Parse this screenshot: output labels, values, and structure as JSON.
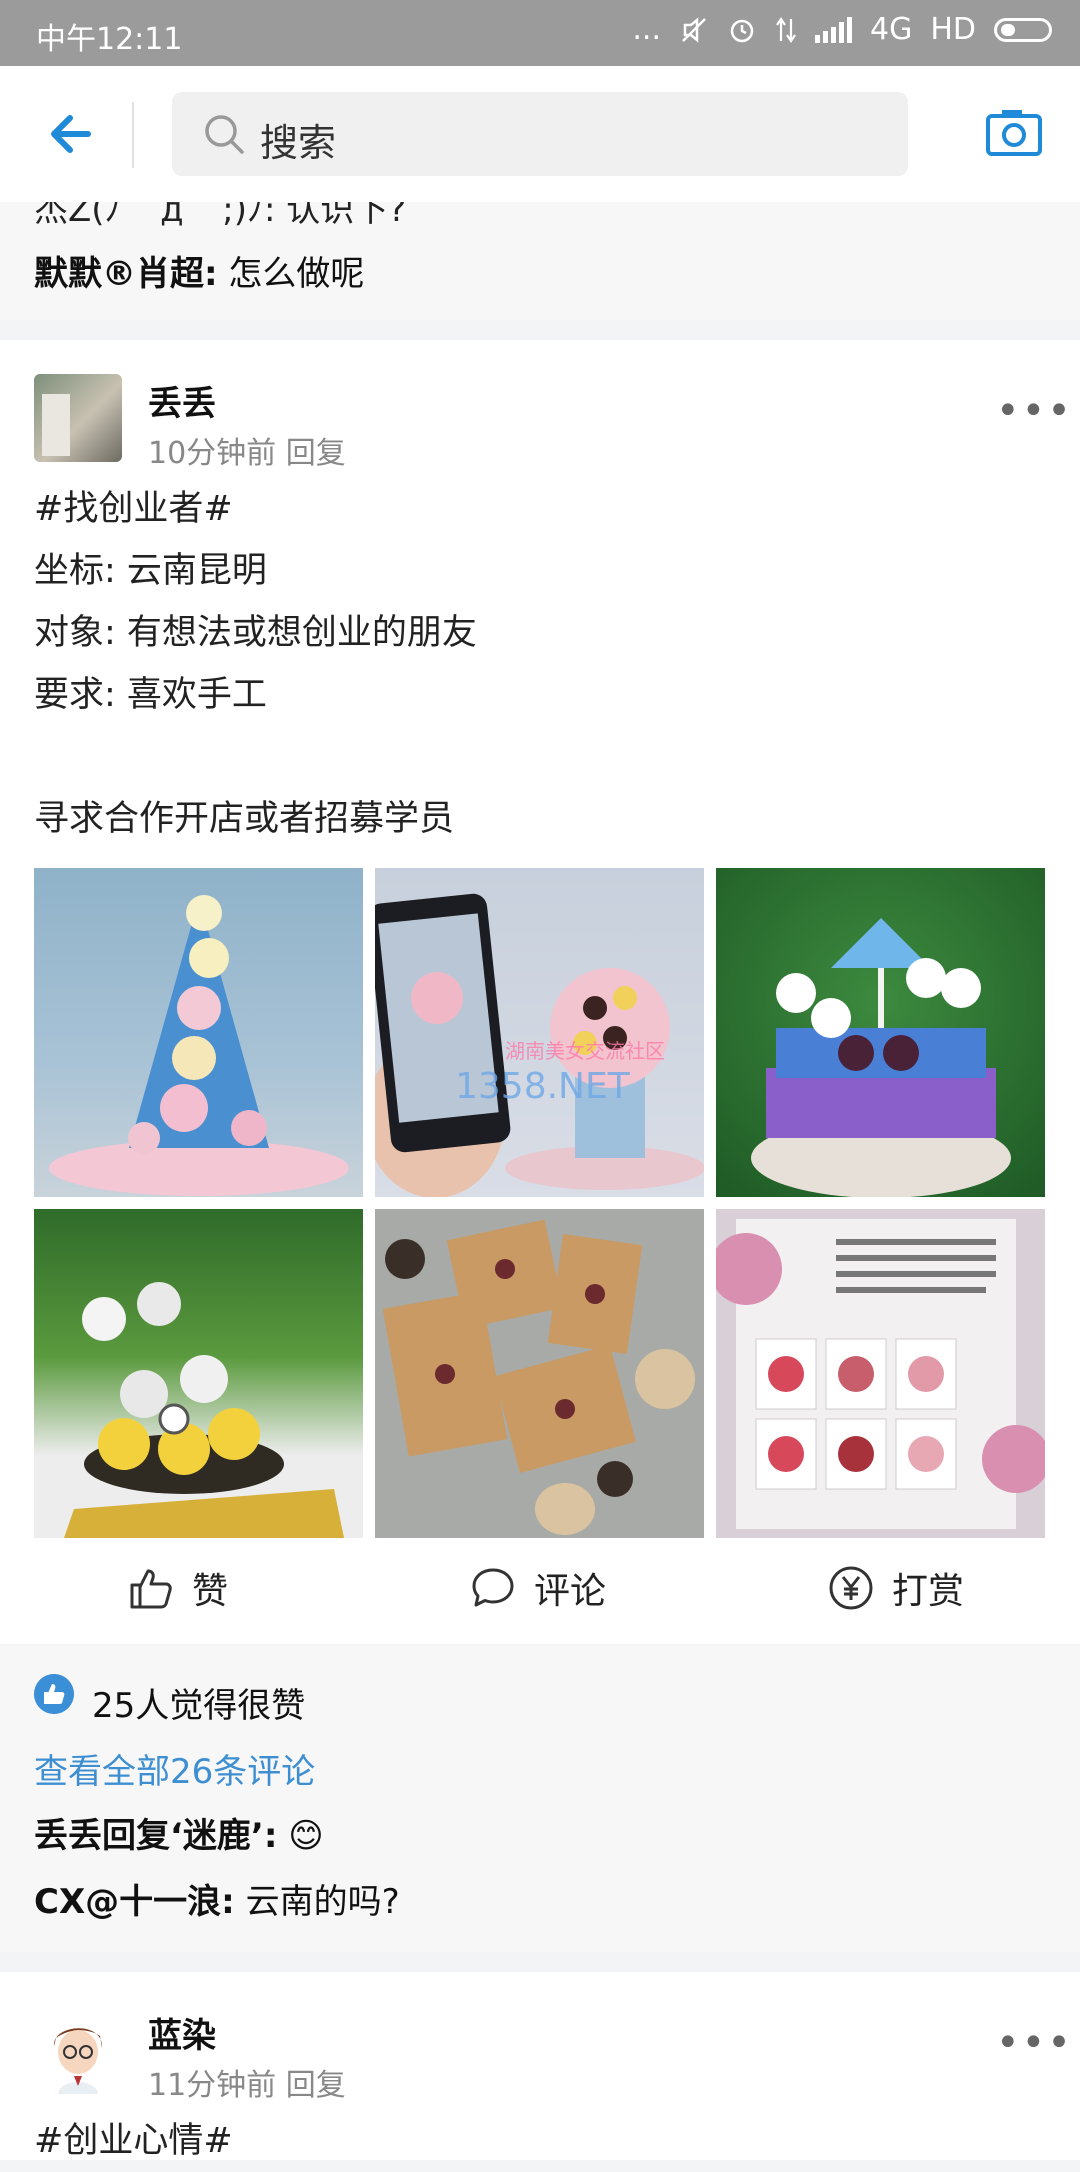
{
  "status": {
    "time": "中午12:11",
    "dots": "...",
    "network": "4G",
    "hd": "HD"
  },
  "search": {
    "placeholder": "搜索"
  },
  "prev_card": {
    "partial_line": "杰Z(ﾉ ´ д ` ;)ﾉ: 认识下?",
    "comment_user": "默默®肖超:",
    "comment_text": "怎么做呢"
  },
  "post": {
    "username": "丢丢",
    "time": "10分钟前",
    "reply": "回复",
    "more": "•••",
    "lines": [
      "#找创业者#",
      "坐标: 云南昆明",
      "对象: 有想法或想创业的朋友",
      "要求: 喜欢手工",
      "",
      "寻求合作开店或者招募学员"
    ],
    "images": [
      "blue strawberry tower",
      "phone photo of fruit bouquet",
      "carousel strawberry cake",
      "minion strawberry tower",
      "boxed chocolate strawberries",
      "flyer with fruit arrangements"
    ],
    "watermark_1": "湖南美女交流社区",
    "watermark_2": "1358.NET",
    "actions": {
      "like": "赞",
      "comment": "评论",
      "reward": "打赏"
    }
  },
  "engagement": {
    "likes": "25人觉得很赞",
    "view_all": "查看全部26条评论",
    "comments": [
      {
        "user": "丢丢回复‘迷鹿’:",
        "text": "😊"
      },
      {
        "user": "CX@十一浪:",
        "text": "云南的吗?"
      }
    ]
  },
  "next_post": {
    "username": "蓝染",
    "time": "11分钟前",
    "reply": "回复",
    "more": "•••",
    "first_line": "#创业心情#"
  }
}
